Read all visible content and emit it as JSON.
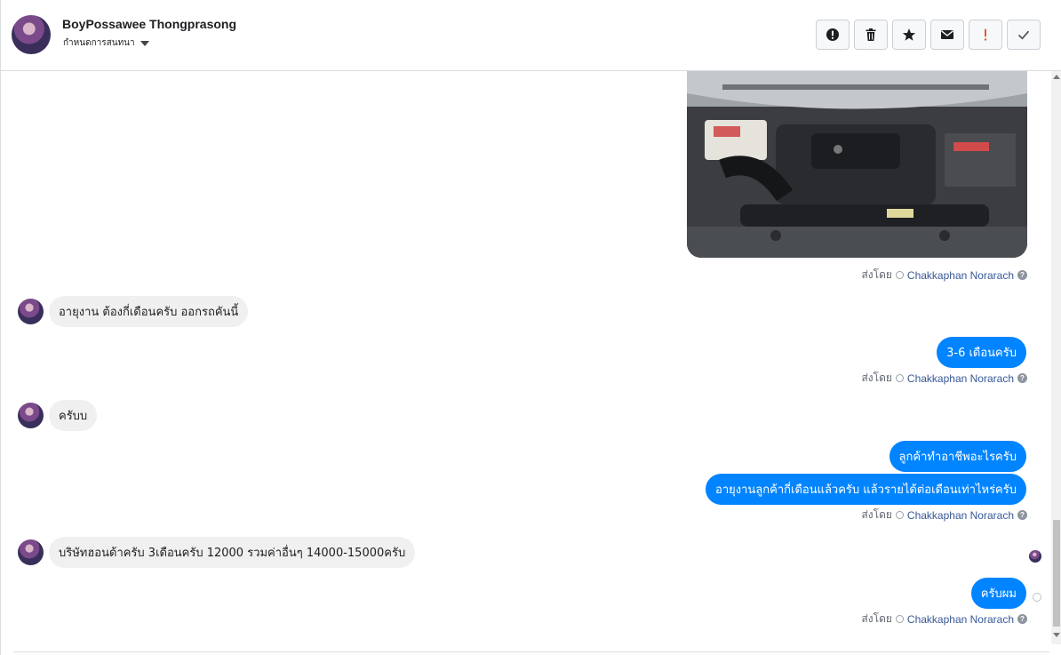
{
  "header": {
    "contact_name": "BoyPossawee Thongprasong",
    "subtitle": "กำหนดการสนทนา",
    "actions": [
      {
        "name": "report-spam",
        "icon": "alert-circle-icon"
      },
      {
        "name": "delete",
        "icon": "trash-icon"
      },
      {
        "name": "star",
        "icon": "star-icon"
      },
      {
        "name": "mark-unread",
        "icon": "envelope-icon"
      },
      {
        "name": "important",
        "icon": "exclamation-icon"
      },
      {
        "name": "done",
        "icon": "checkmark-icon"
      }
    ]
  },
  "sent_by": {
    "prefix": "ส่งโดย",
    "agent": "Chakkaphan Norarach"
  },
  "messages": [
    {
      "direction": "in",
      "text": "อายุงาน ต้องกี่เดือนครับ ออกรถคันนี้"
    },
    {
      "direction": "out",
      "text": "3-6 เดือนครับ"
    },
    {
      "direction": "in",
      "text": "ครับบ"
    },
    {
      "direction": "out",
      "text": "ลูกค้าทำอาชีพอะไรครับ"
    },
    {
      "direction": "out",
      "text": "อายุงานลูกค้ากี่เดือนแล้วครับ แล้วรายได้ต่อเดือนเท่าไหร่ครับ"
    },
    {
      "direction": "in",
      "text": "บริษัทฮอนด้าครับ 3เดือนครับ 12000 รวมค่าอื่นๆ 14000-15000ครับ"
    },
    {
      "direction": "out",
      "text": "ครับผม"
    }
  ],
  "colors": {
    "outgoing_bubble": "#0084ff",
    "incoming_bubble": "#f1f0f0",
    "agent_link": "#385898",
    "important_icon": "#f02849"
  }
}
